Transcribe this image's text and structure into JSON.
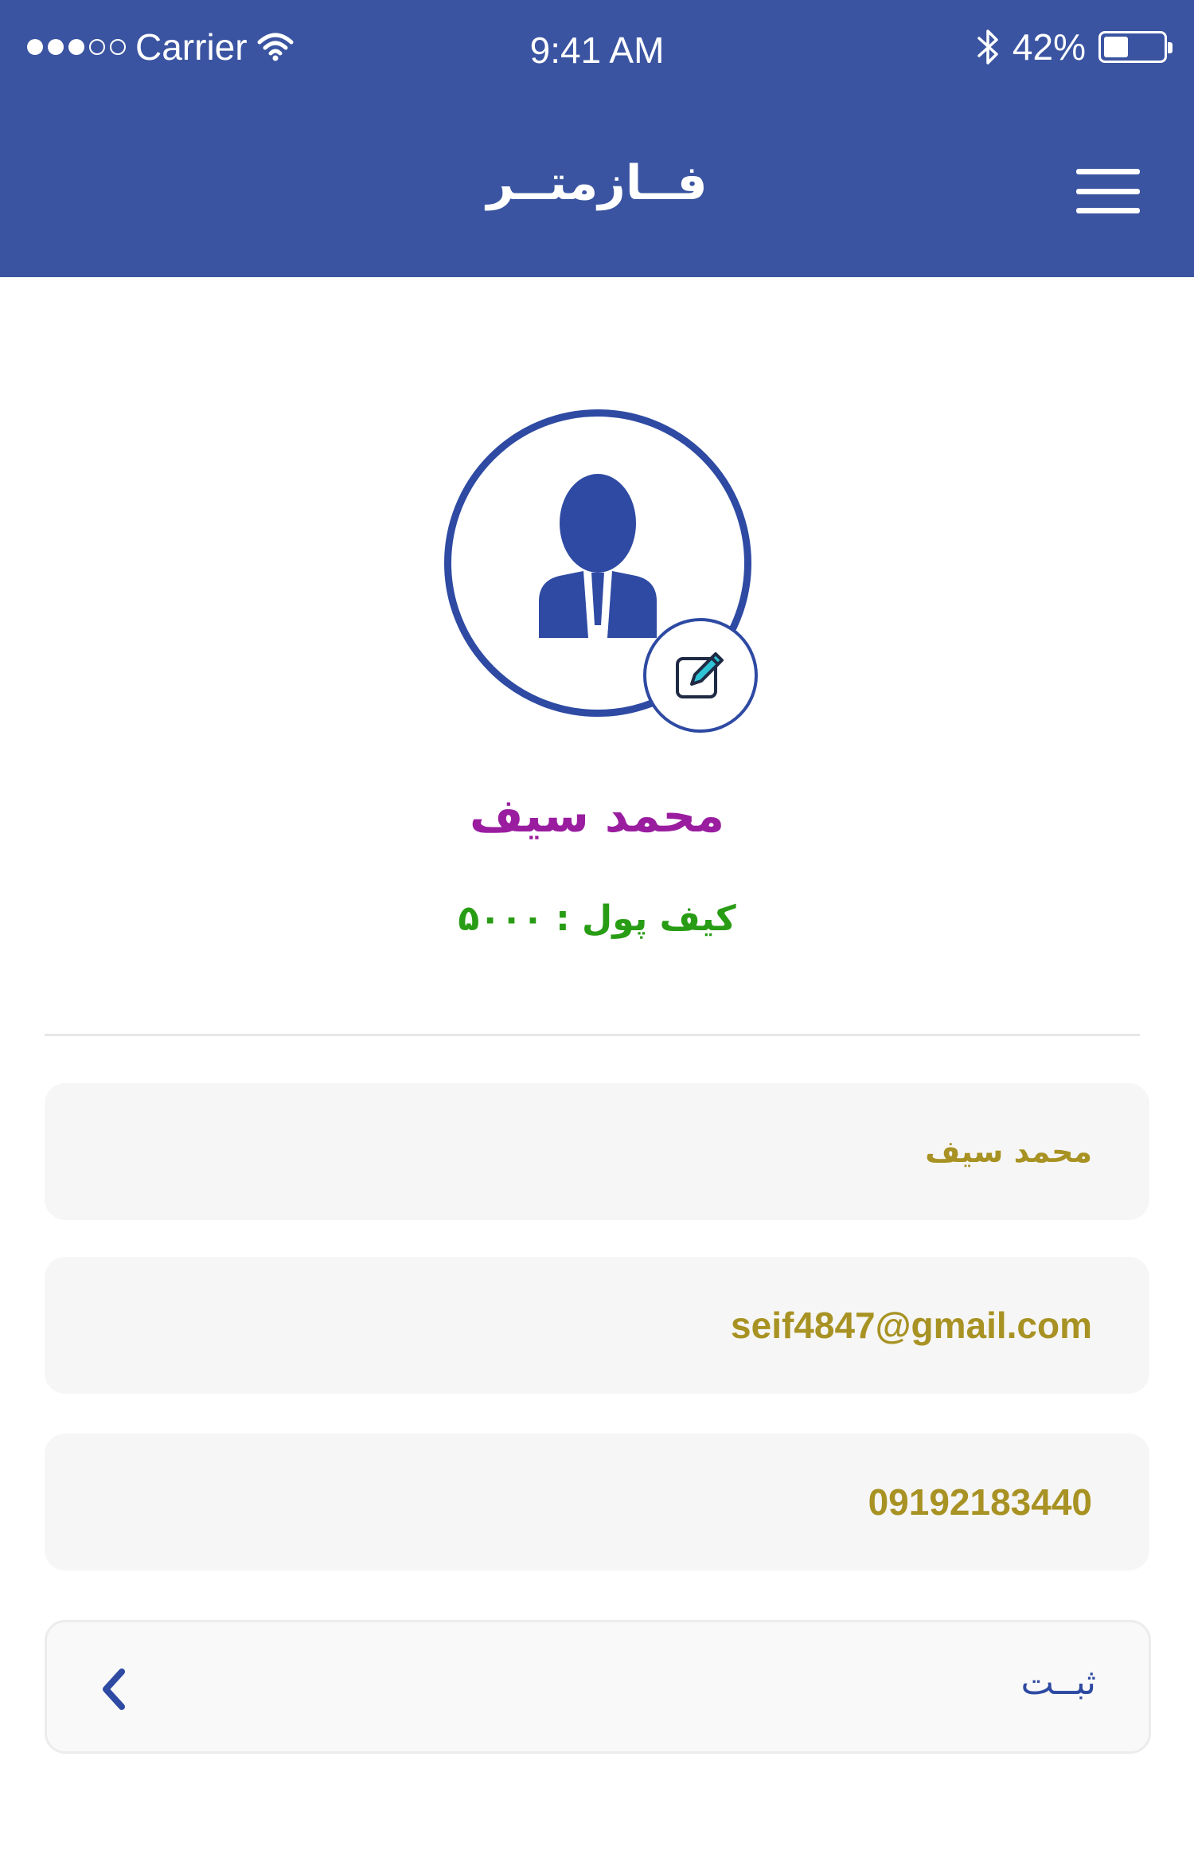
{
  "status_bar": {
    "carrier": "Carrier",
    "time": "9:41 AM",
    "battery": "42%",
    "battery_level": 0.42
  },
  "header": {
    "title": "فــازمتــر",
    "menu_icon": "hamburger-menu-icon"
  },
  "profile": {
    "avatar_icon": "user-avatar-icon",
    "edit_icon": "edit-icon",
    "name": "محمد سیف",
    "wallet": "کیف پول : ۵۰۰۰"
  },
  "form": {
    "name_value": "محمد سیف",
    "email_value": "seif4847@gmail.com",
    "phone_value": "09192183440"
  },
  "submit": {
    "label": "ثبــت",
    "icon": "chevron-left-icon"
  },
  "colors": {
    "primary": "#3a54a1",
    "accent_blue": "#2e4aa3",
    "name_purple": "#9a1da0",
    "wallet_green": "#289c14",
    "field_text_gold": "#a89223",
    "field_bg": "#f6f6f6"
  }
}
